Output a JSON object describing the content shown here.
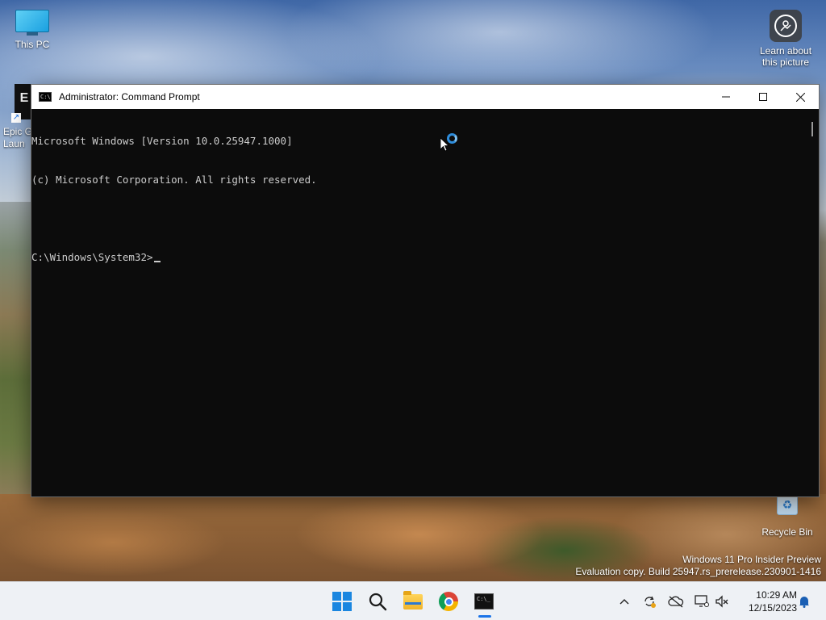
{
  "desktop": {
    "icons": {
      "this_pc": "This PC",
      "learn_line1": "Learn about",
      "learn_line2": "this picture",
      "epic_line1": "Epic G",
      "epic_line2": "Laun",
      "recycle_bin": "Recycle Bin"
    },
    "watermark": {
      "line1": "Windows 11 Pro Insider Preview",
      "line2": "Evaluation copy. Build 25947.rs_prerelease.230901-1416"
    }
  },
  "window": {
    "title": "Administrator: Command Prompt",
    "icon": "cmd-icon",
    "controls": {
      "minimize": "—",
      "maximize": "☐",
      "close": "✕"
    }
  },
  "console": {
    "line1": "Microsoft Windows [Version 10.0.25947.1000]",
    "line2": "(c) Microsoft Corporation. All rights reserved.",
    "prompt": "C:\\Windows\\System32>"
  },
  "taskbar": {
    "apps": [
      "start-icon",
      "search-icon",
      "file-explorer-icon",
      "chrome-icon",
      "command-prompt-icon"
    ],
    "tray": {
      "chevron": "^",
      "time": "10:29 AM",
      "date": "12/15/2023"
    }
  },
  "colors": {
    "console_bg": "#0c0c0c",
    "console_text": "#cccccc",
    "accent": "#1a73e8"
  }
}
